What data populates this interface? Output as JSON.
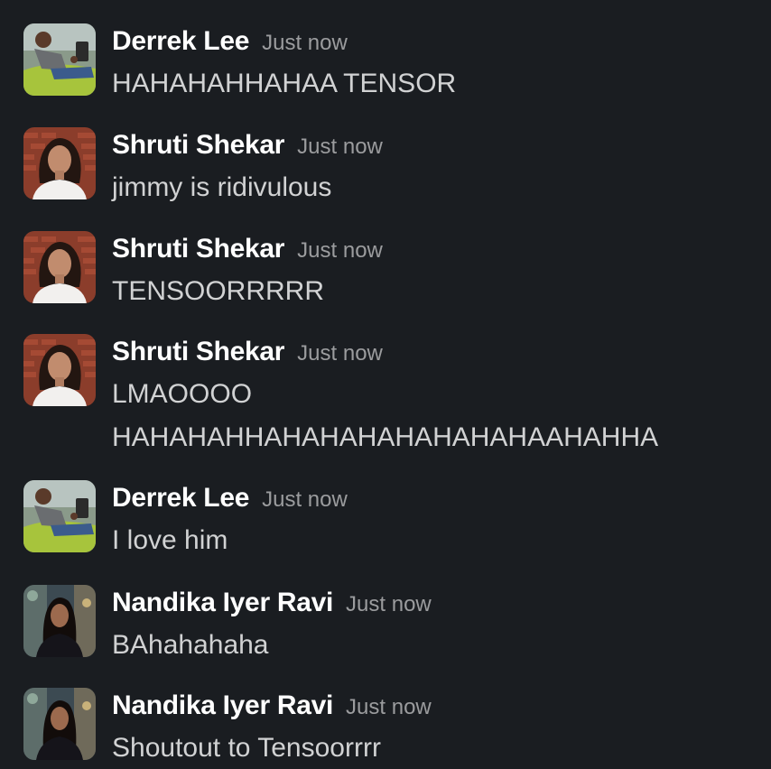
{
  "messages": [
    {
      "author": "Derrek Lee",
      "avatar": "derrek-avatar",
      "time": "Just now",
      "lines": [
        "HAHAHAHHAHAA TENSOR"
      ]
    },
    {
      "author": "Shruti Shekar",
      "avatar": "shruti-avatar",
      "time": "Just now",
      "lines": [
        "jimmy is ridivulous"
      ]
    },
    {
      "author": "Shruti Shekar",
      "avatar": "shruti-avatar",
      "time": "Just now",
      "lines": [
        "TENSOORRRRR"
      ]
    },
    {
      "author": "Shruti Shekar",
      "avatar": "shruti-avatar",
      "time": "Just now",
      "lines": [
        "LMAOOOO",
        "HAHAHAHHAHAHAHAHAHAHAHAAHAHHA"
      ]
    },
    {
      "author": "Derrek Lee",
      "avatar": "derrek-avatar",
      "time": "Just now",
      "lines": [
        "I love him"
      ]
    },
    {
      "author": "Nandika Iyer Ravi",
      "avatar": "nandika-avatar",
      "time": "Just now",
      "lines": [
        "BAhahahaha"
      ]
    },
    {
      "author": "Nandika Iyer Ravi",
      "avatar": "nandika-avatar",
      "time": "Just now",
      "lines": [
        "Shoutout to Tensoorrrr"
      ]
    }
  ],
  "colors": {
    "background": "#1a1d21",
    "name": "#ffffff",
    "timestamp": "#9b9c9e",
    "message": "#d1d2d3"
  }
}
